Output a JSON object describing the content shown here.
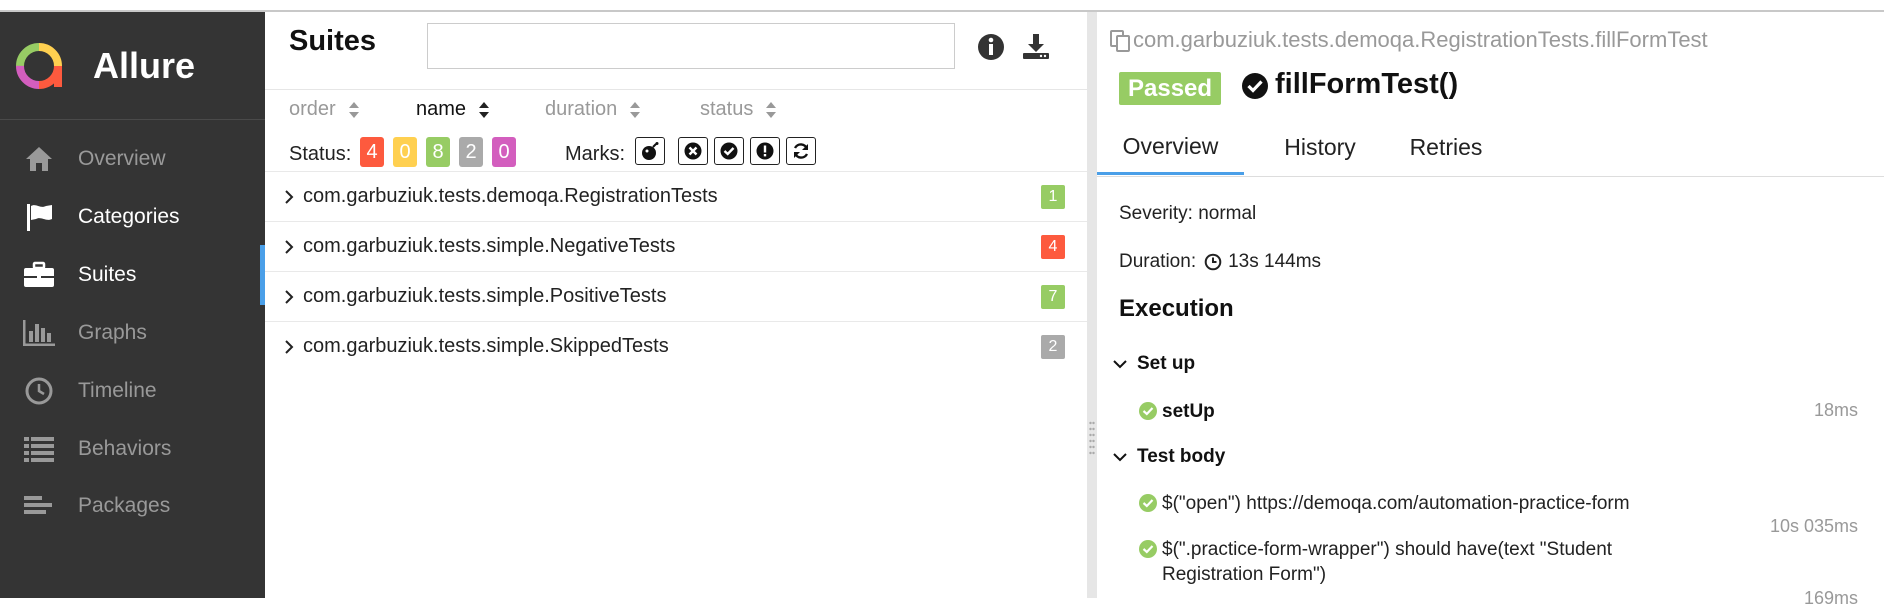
{
  "app": {
    "name": "Allure"
  },
  "sidebar": {
    "items": [
      {
        "label": "Overview",
        "icon": "home-icon"
      },
      {
        "label": "Categories",
        "icon": "flag-icon"
      },
      {
        "label": "Suites",
        "icon": "briefcase-icon"
      },
      {
        "label": "Graphs",
        "icon": "bar-chart-icon"
      },
      {
        "label": "Timeline",
        "icon": "clock-icon"
      },
      {
        "label": "Behaviors",
        "icon": "list-icon"
      },
      {
        "label": "Packages",
        "icon": "packages-icon"
      }
    ],
    "active": "Suites"
  },
  "suites": {
    "title": "Suites",
    "search_value": "",
    "sort": [
      {
        "label": "order"
      },
      {
        "label": "name"
      },
      {
        "label": "duration"
      },
      {
        "label": "status"
      }
    ],
    "status_label": "Status:",
    "status_counts": [
      {
        "value": "4",
        "color": "#fd5a3e"
      },
      {
        "value": "0",
        "color": "#ffd050"
      },
      {
        "value": "8",
        "color": "#97cc64"
      },
      {
        "value": "2",
        "color": "#aaaaaa"
      },
      {
        "value": "0",
        "color": "#d35ebe"
      }
    ],
    "marks_label": "Marks:",
    "marks": [
      "bomb-icon",
      "times-circle-icon",
      "check-circle-icon",
      "exclamation-circle-icon",
      "refresh-icon"
    ],
    "rows": [
      {
        "name": "com.garbuziuk.tests.demoqa.RegistrationTests",
        "count": "1",
        "color": "#97cc64"
      },
      {
        "name": "com.garbuziuk.tests.simple.NegativeTests",
        "count": "4",
        "color": "#fd5a3e"
      },
      {
        "name": "com.garbuziuk.tests.simple.PositiveTests",
        "count": "7",
        "color": "#97cc64"
      },
      {
        "name": "com.garbuziuk.tests.simple.SkippedTests",
        "count": "2",
        "color": "#aaaaaa"
      }
    ]
  },
  "test": {
    "full_name": "com.garbuziuk.tests.demoqa.RegistrationTests.fillFormTest",
    "status": "Passed",
    "name": "fillFormTest()",
    "tabs": [
      "Overview",
      "History",
      "Retries"
    ],
    "severity": "Severity: normal",
    "duration_label": "Duration:",
    "duration_value": "13s 144ms",
    "execution_title": "Execution",
    "setup_label": "Set up",
    "setup_steps": [
      {
        "name": "setUp",
        "duration": "18ms"
      }
    ],
    "body_label": "Test body",
    "body_steps": [
      {
        "line1": "$(\"open\") https://demoqa.com/automation-practice-form",
        "duration": "10s 035ms"
      },
      {
        "line1": "$(\".practice-form-wrapper\") should have(text \"Student",
        "line2": "Registration Form\")",
        "duration": "169ms"
      }
    ]
  }
}
